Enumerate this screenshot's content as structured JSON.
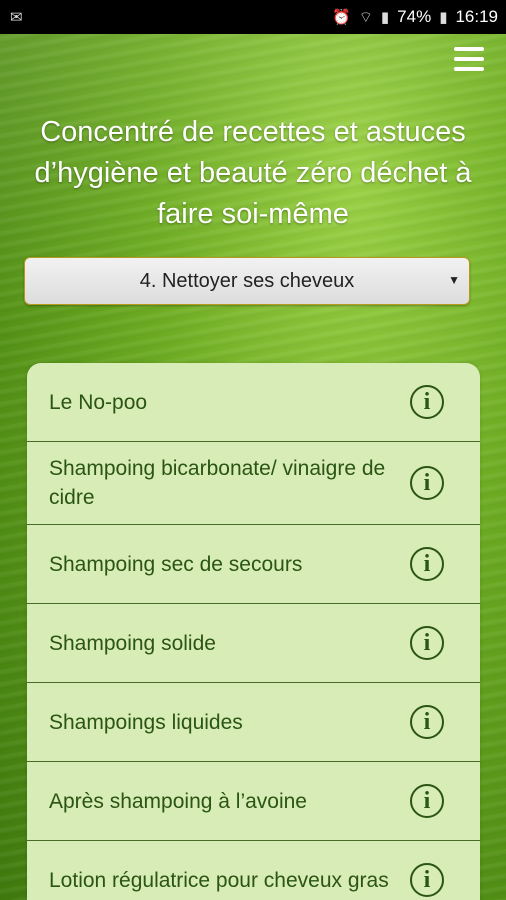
{
  "status_bar": {
    "left_icon": "mail-icon",
    "battery": "74%",
    "time": "16:19"
  },
  "header": {
    "title": "Concentré de recettes et astuces d’hygiène et beauté zéro déchet à faire soi-même"
  },
  "category_select": {
    "selected": "4. Nettoyer ses cheveux"
  },
  "recipes": [
    {
      "label": "Le No-poo"
    },
    {
      "label": "Shampoing bicarbonate/ vinaigre de cidre"
    },
    {
      "label": "Shampoing sec de secours"
    },
    {
      "label": "Shampoing solide"
    },
    {
      "label": "Shampoings liquides"
    },
    {
      "label": "Après shampoing à l’avoine"
    },
    {
      "label": "Lotion régulatrice pour cheveux gras"
    }
  ],
  "colors": {
    "accent_green": "#2a5512",
    "list_background": "#d8ecb8"
  }
}
